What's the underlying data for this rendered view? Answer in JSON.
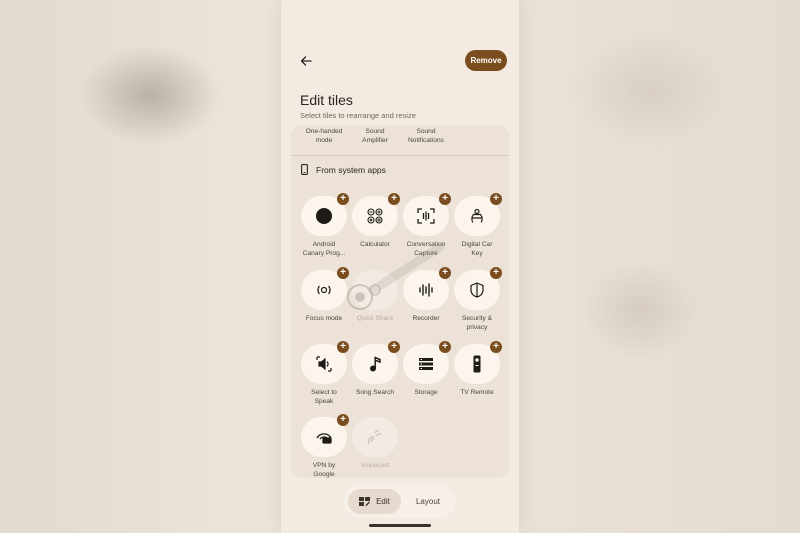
{
  "header": {
    "remove_label": "Remove",
    "title": "Edit tiles",
    "subtitle": "Select tiles to rearrange and resize"
  },
  "top_tiles": [
    {
      "label": "One-handed\nmode"
    },
    {
      "label": "Sound\nAmplifier"
    },
    {
      "label": "Sound\nNotifications"
    }
  ],
  "section": {
    "title": "From system apps",
    "icon": "phone-icon"
  },
  "tiles": [
    {
      "label": "Android\nCanary Prog...",
      "icon": "dot-icon",
      "addable": true
    },
    {
      "label": "Calculator",
      "icon": "calculator-icon",
      "addable": true
    },
    {
      "label": "Conversation\nCapture",
      "icon": "capture-icon",
      "addable": true
    },
    {
      "label": "Digital Car\nKey",
      "icon": "car-key-icon",
      "addable": true
    },
    {
      "label": "Focus mode",
      "icon": "focus-icon",
      "addable": true
    },
    {
      "label": "Quick Share",
      "icon": "quick-share-icon",
      "addable": false
    },
    {
      "label": "Recorder",
      "icon": "recorder-icon",
      "addable": true
    },
    {
      "label": "Security &\nprivacy",
      "icon": "shield-icon",
      "addable": true
    },
    {
      "label": "Select to\nSpeak",
      "icon": "speak-icon",
      "addable": true
    },
    {
      "label": "Song Search",
      "icon": "music-note-icon",
      "addable": true
    },
    {
      "label": "Storage",
      "icon": "storage-icon",
      "addable": true
    },
    {
      "label": "TV Remote",
      "icon": "tv-remote-icon",
      "addable": true
    },
    {
      "label": "VPN by\nGoogle",
      "icon": "vpn-icon",
      "addable": true
    },
    {
      "label": "Voicecast",
      "icon": "voicecast-icon",
      "addable": false
    }
  ],
  "bottom_bar": {
    "edit_label": "Edit",
    "layout_label": "Layout"
  },
  "colors": {
    "accent": "#7a4d1e",
    "phone_bg": "#f3ebe1",
    "panel_bg": "#ece2d7"
  }
}
